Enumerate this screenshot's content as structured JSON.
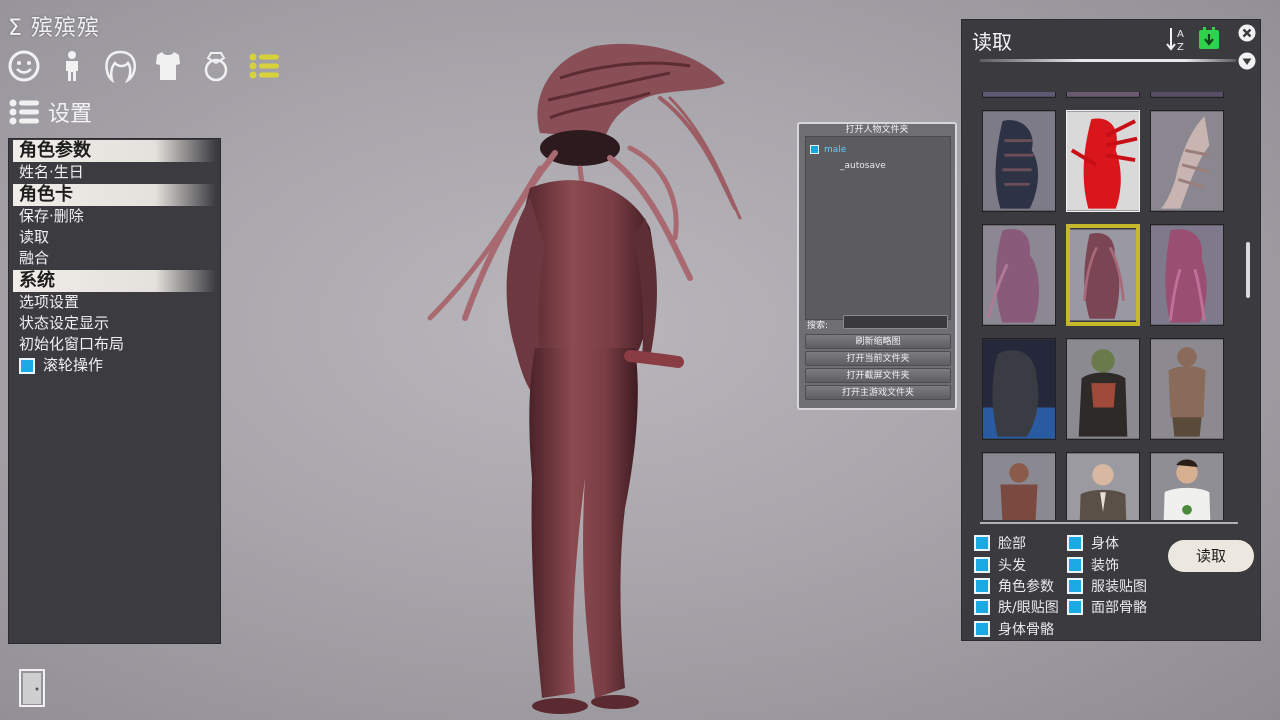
{
  "app": {
    "title": "Σ 殡殡殡"
  },
  "category_icons": [
    {
      "name": "face-icon"
    },
    {
      "name": "body-icon"
    },
    {
      "name": "hair-icon"
    },
    {
      "name": "clothes-icon"
    },
    {
      "name": "accessory-ring-icon"
    },
    {
      "name": "settings-list-icon"
    }
  ],
  "settings_header": {
    "label": "设置"
  },
  "left_menu": {
    "section1": "角色参数",
    "item_name_birthday": "姓名·生日",
    "section2": "角色卡",
    "item_save_delete": "保存·删除",
    "item_load": "读取",
    "item_merge": "融合",
    "section3": "系统",
    "item_options": "选项设置",
    "item_status_display": "状态设定显示",
    "item_reset_layout": "初始化窗口布局",
    "item_wheel": "滚轮操作"
  },
  "folder_panel": {
    "title": "打开人物文件夹",
    "tree_root": "male",
    "tree_child": "_autosave",
    "search_label": "搜索:",
    "buttons": [
      "刷新缩略图",
      "打开当前文件夹",
      "打开截屏文件夹",
      "打开主游戏文件夹"
    ]
  },
  "load_panel": {
    "title": "读取",
    "load_button": "读取",
    "options_left": [
      "脸部",
      "头发",
      "角色参数",
      "肤/眼贴图",
      "身体骨骼"
    ],
    "options_right": [
      "身体",
      "装饰",
      "服装贴图",
      "面部骨骼"
    ]
  },
  "colors": {
    "accent_checkbox": "#19a9e3",
    "highlight_border": "#c7b82a",
    "icon_active": "#d8d23a",
    "save_icon": "#2fd24a"
  }
}
